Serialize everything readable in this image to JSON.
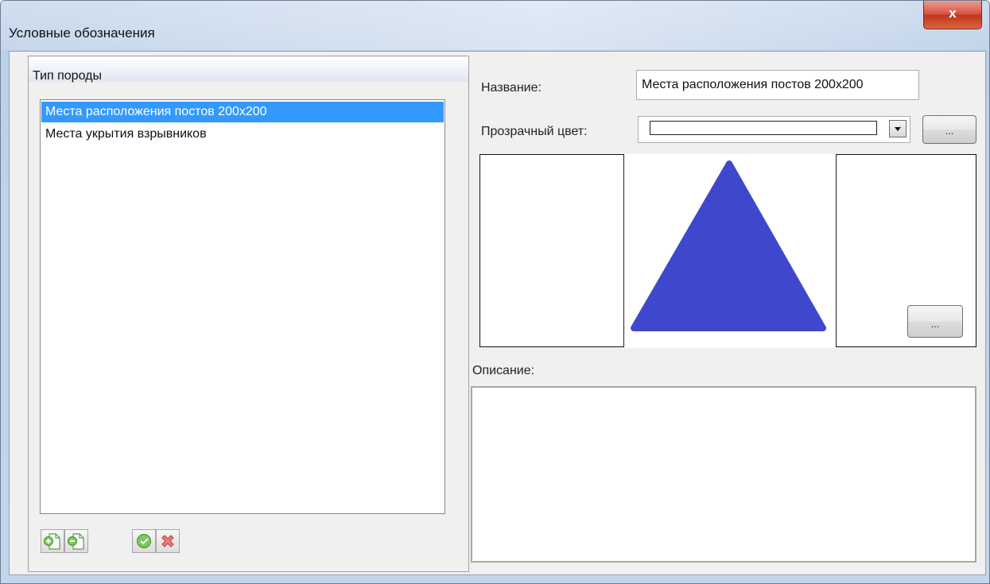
{
  "window": {
    "title": "Условные обозначения",
    "close_label": "x"
  },
  "left_panel": {
    "group_title": "Тип породы",
    "items": [
      {
        "label": "Места расположения постов 200x200",
        "selected": true
      },
      {
        "label": "Места укрытия взрывников",
        "selected": false
      }
    ],
    "toolbar": {
      "add_icon": "add-document-icon",
      "remove_icon": "remove-document-icon",
      "apply_icon": "checkmark-icon",
      "cancel_icon": "red-x-icon"
    }
  },
  "right_panel": {
    "name_label": "Название:",
    "name_value": "Места расположения постов 200x200",
    "transparent_color_label": "Прозрачный цвет:",
    "browse_label": "...",
    "image_browse_label": "...",
    "description_label": "Описание:",
    "description_value": "",
    "symbol": {
      "shape": "triangle",
      "color": "#3f48cc"
    }
  },
  "colors": {
    "selection": "#3399ff",
    "close_button": "#c7432f"
  }
}
